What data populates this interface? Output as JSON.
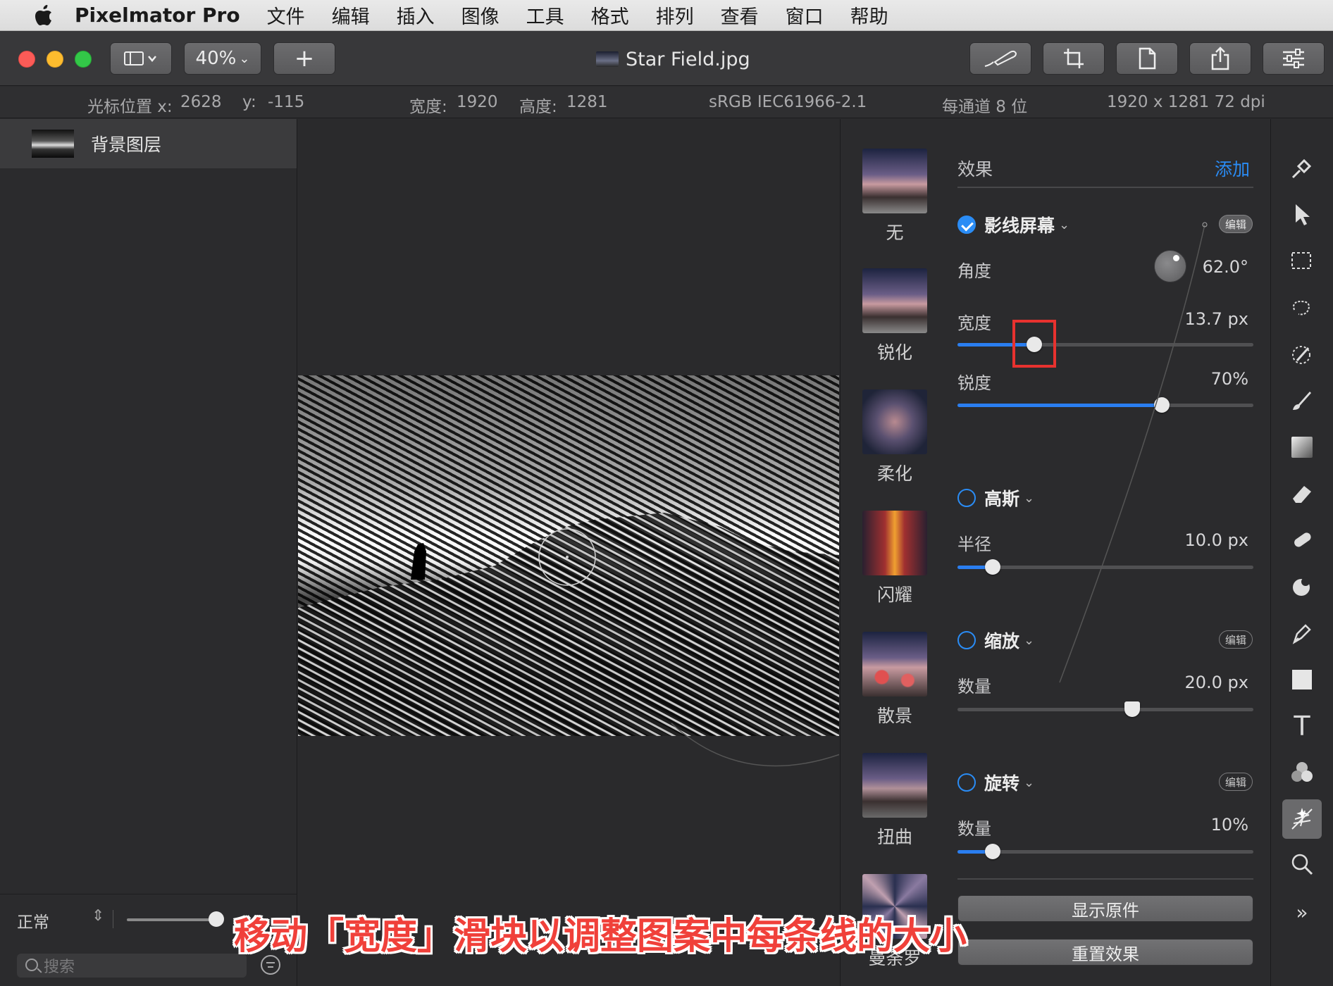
{
  "menubar": {
    "app_name": "Pixelmator Pro",
    "items": [
      "文件",
      "编辑",
      "插入",
      "图像",
      "工具",
      "格式",
      "排列",
      "查看",
      "窗口",
      "帮助"
    ]
  },
  "toolbar": {
    "zoom": "40%",
    "add_label": "+",
    "doc_title": "Star Field.jpg"
  },
  "infobar": {
    "cursor_label": "光标位置 x:",
    "cursor_x": "2628",
    "cursor_y_label": "y:",
    "cursor_y": "-115",
    "width_label": "宽度:",
    "width": "1920",
    "height_label": "高度:",
    "height": "1281",
    "color_profile": "sRGB IEC61966-2.1",
    "bit_depth": "每通道 8 位",
    "resolution": "1920 x 1281 72 dpi"
  },
  "layers": {
    "items": [
      {
        "name": "背景图层"
      }
    ],
    "blend_mode": "正常",
    "opacity_level": 0.9,
    "search_placeholder": "搜索"
  },
  "effects_browser": {
    "items": [
      {
        "label": "无"
      },
      {
        "label": "锐化"
      },
      {
        "label": "柔化"
      },
      {
        "label": "闪耀"
      },
      {
        "label": "散景"
      },
      {
        "label": "扭曲"
      },
      {
        "label": "曼荼罗"
      }
    ]
  },
  "effects_panel": {
    "title": "效果",
    "add_label": "添加",
    "edit_label": "编辑",
    "groups": [
      {
        "name": "影线屏幕",
        "enabled": true,
        "params": [
          {
            "label": "角度",
            "value": "62.0°"
          },
          {
            "label": "宽度",
            "value": "13.7 px",
            "level": 0.26
          },
          {
            "label": "锐度",
            "value": "70%",
            "level": 0.69
          }
        ]
      },
      {
        "name": "高斯",
        "enabled": false,
        "params": [
          {
            "label": "半径",
            "value": "10.0 px",
            "level": 0.12
          }
        ]
      },
      {
        "name": "缩放",
        "enabled": false,
        "params": [
          {
            "label": "数量",
            "value": "20.0 px",
            "level": 0.59
          }
        ]
      },
      {
        "name": "旋转",
        "enabled": false,
        "params": [
          {
            "label": "数量",
            "value": "10%",
            "level": 0.12
          }
        ]
      }
    ],
    "show_original_label": "显示原件",
    "reset_label": "重置效果"
  },
  "caption": "移动「宽度」滑块以调整图案中每条线的大小",
  "colors": {
    "accent": "#2a7ef0",
    "highlight_box": "#e8322f",
    "caption": "#f0403a"
  }
}
